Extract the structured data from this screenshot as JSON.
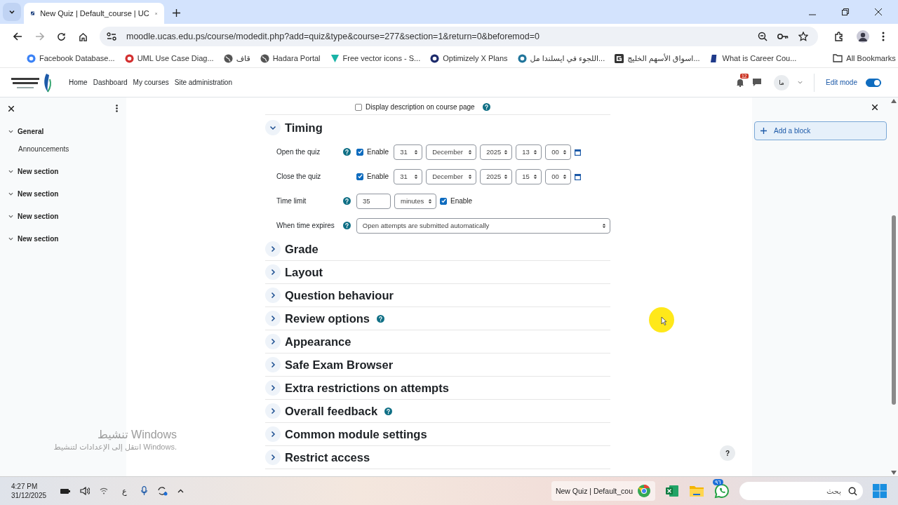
{
  "browser": {
    "tabs": [
      {
        "title": "New Quiz | Default_course | UC",
        "selected": true
      }
    ],
    "address": "moodle.ucas.edu.ps/course/modedit.php?add=quiz&type&course=277&section=1&return=0&beforemod=0",
    "bookmarks": [
      {
        "label": "Facebook Database...",
        "kind": "db"
      },
      {
        "label": "UML Use Case Diag...",
        "kind": "uml"
      },
      {
        "label": "قاف",
        "kind": "globe"
      },
      {
        "label": "Hadara Portal",
        "kind": "globe"
      },
      {
        "label": "Free vector icons - S...",
        "kind": "vector"
      },
      {
        "label": "Optimizely X Plans",
        "kind": "opt"
      },
      {
        "label": "اللجوء في ايسلندا مل...",
        "kind": "wp"
      },
      {
        "label": "اسواق الأسهم الخليج...",
        "kind": "g"
      },
      {
        "label": "What is Career Cou...",
        "kind": "b"
      }
    ],
    "all_bookmarks": "All Bookmarks"
  },
  "navbar": {
    "links": [
      "Home",
      "Dashboard",
      "My courses",
      "Site administration"
    ],
    "notifications": "12",
    "avatar": "ما",
    "edit_mode": {
      "label": "Edit mode",
      "on": true
    }
  },
  "course_index": [
    {
      "label": "General",
      "expanded": true,
      "children": [
        {
          "label": "Announcements"
        }
      ]
    },
    {
      "label": "New section",
      "expanded": true
    },
    {
      "label": "New section",
      "expanded": true
    },
    {
      "label": "New section",
      "expanded": true
    },
    {
      "label": "New section",
      "expanded": true
    }
  ],
  "display_description": {
    "label": "Display description on course page",
    "checked": false,
    "help": true
  },
  "timing": {
    "title": "Timing",
    "expanded": true,
    "fields": [
      {
        "kind": "datetime",
        "label": "Open the quiz",
        "help": true,
        "enabled": true,
        "enable_label": "Enable",
        "day": "31",
        "month": "December",
        "year": "2025",
        "hour": "13",
        "minute": "00"
      },
      {
        "kind": "datetime",
        "label": "Close the quiz",
        "help": false,
        "enabled": true,
        "enable_label": "Enable",
        "day": "31",
        "month": "December",
        "year": "2025",
        "hour": "15",
        "minute": "00"
      },
      {
        "kind": "duration",
        "label": "Time limit",
        "help": true,
        "value": "35",
        "unit": "minutes",
        "enabled": true,
        "enable_label": "Enable"
      },
      {
        "kind": "select",
        "label": "When time expires",
        "help": true,
        "value": "Open attempts are submitted automatically"
      }
    ]
  },
  "sections": [
    {
      "title": "Grade",
      "help": false,
      "expanded": false
    },
    {
      "title": "Layout",
      "help": false,
      "expanded": false
    },
    {
      "title": "Question behaviour",
      "help": false,
      "expanded": false
    },
    {
      "title": "Review options",
      "help": true,
      "expanded": false
    },
    {
      "title": "Appearance",
      "help": false,
      "expanded": false
    },
    {
      "title": "Safe Exam Browser",
      "help": false,
      "expanded": false
    },
    {
      "title": "Extra restrictions on attempts",
      "help": false,
      "expanded": false
    },
    {
      "title": "Overall feedback",
      "help": true,
      "expanded": false
    },
    {
      "title": "Common module settings",
      "help": false,
      "expanded": false
    },
    {
      "title": "Restrict access",
      "help": false,
      "expanded": false
    }
  ],
  "block_drawer": {
    "add_block": "Add a block"
  },
  "help_button": "?",
  "activation": {
    "title": "تنشيط Windows",
    "text": "انتقل إلى الإعدادات لتنشيط Windows."
  },
  "taskbar": {
    "time": "4:27 PM",
    "date": "31/12/2025",
    "language": "ع",
    "app": "New Quiz | Default_cou",
    "whatsapp_badge": "٩٦",
    "search_placeholder": "بحث"
  }
}
